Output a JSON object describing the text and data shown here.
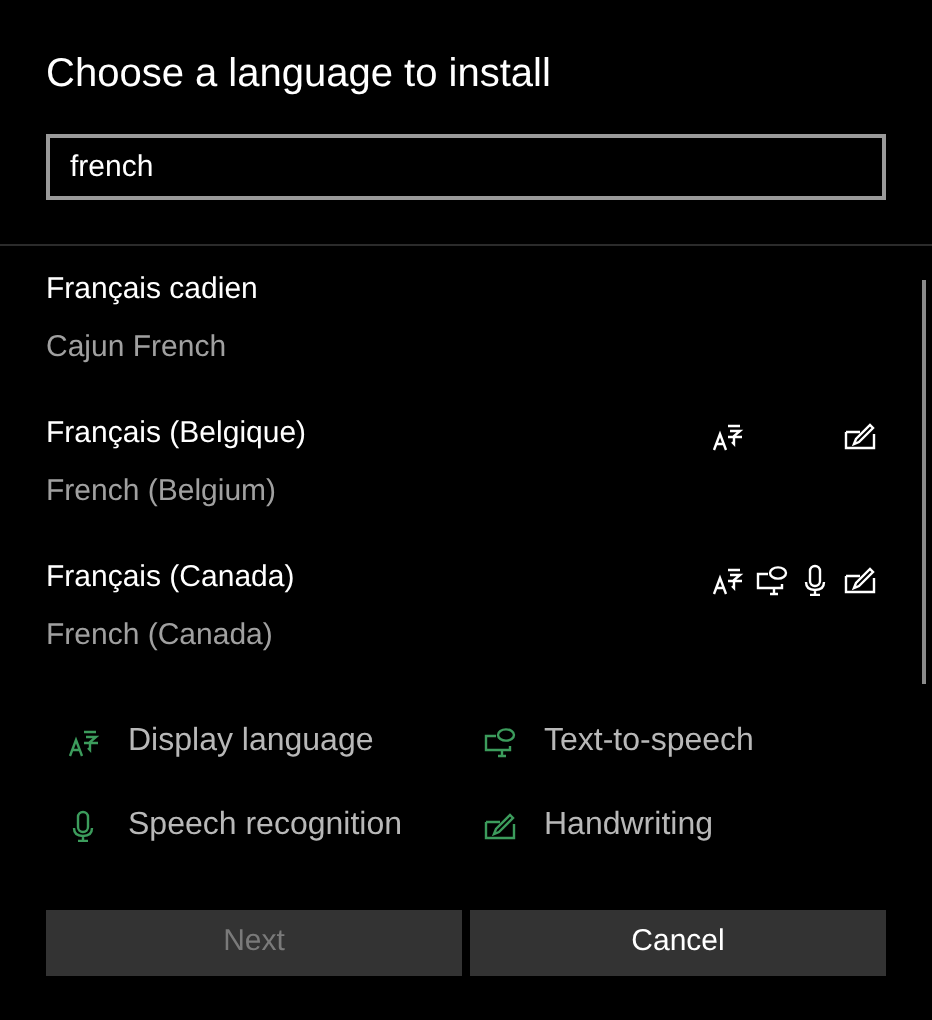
{
  "title": "Choose a language to install",
  "search": {
    "value": "french"
  },
  "languages": [
    {
      "name": "Français cadien",
      "english": "Cajun French",
      "features": {
        "display": false,
        "tts": false,
        "speech": false,
        "handwriting": false
      }
    },
    {
      "name": "Français (Belgique)",
      "english": "French (Belgium)",
      "features": {
        "display": true,
        "tts": false,
        "speech": false,
        "handwriting": true
      }
    },
    {
      "name": "Français (Canada)",
      "english": "French (Canada)",
      "features": {
        "display": true,
        "tts": true,
        "speech": true,
        "handwriting": true
      }
    }
  ],
  "legend": [
    {
      "kind": "display",
      "label": "Display language"
    },
    {
      "kind": "tts",
      "label": "Text-to-speech"
    },
    {
      "kind": "speech",
      "label": "Speech recognition"
    },
    {
      "kind": "handwriting",
      "label": "Handwriting"
    }
  ],
  "buttons": [
    {
      "label": "Next",
      "disabled": true
    },
    {
      "label": "Cancel",
      "disabled": false
    }
  ]
}
